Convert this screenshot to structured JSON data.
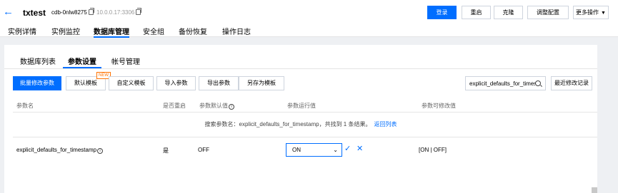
{
  "header": {
    "instance_name": "txtest",
    "instance_id": "cdb-0nlw8275",
    "instance_ip": "10.0.0.17:3306",
    "buttons": {
      "login": "登录",
      "restart": "重启",
      "clone": "克隆",
      "adjust_config": "调整配置",
      "more_actions": "更多操作"
    }
  },
  "main_tabs": [
    "实例详情",
    "实例监控",
    "数据库管理",
    "安全组",
    "备份恢复",
    "操作日志"
  ],
  "sub_tabs": [
    "数据库列表",
    "参数设置",
    "帐号管理"
  ],
  "toolbar": {
    "batch_edit": "批量修改参数",
    "default_template": "默认模板",
    "new_badge": "NEW",
    "custom_template": "自定义模板",
    "import_params": "导入参数",
    "export_params": "导出参数",
    "save_as_template": "另存为模板",
    "search_value": "explicit_defaults_for_timestamp",
    "recent_changes": "最近修改记录"
  },
  "table": {
    "columns": [
      "参数名",
      "是否重启",
      "参数默认值",
      "参数运行值",
      "参数可修改值"
    ],
    "search_result": {
      "text": "搜索参数名：explicit_defaults_for_timestamp，共找到 1 条结果。",
      "link": "返回列表"
    },
    "rows": [
      {
        "name": "explicit_defaults_for_timestamp",
        "restart": "是",
        "default": "OFF",
        "running": "ON",
        "allowed": "[ON | OFF]"
      }
    ]
  },
  "colors": {
    "accent": "#006eff",
    "badge": "#ff7200"
  }
}
